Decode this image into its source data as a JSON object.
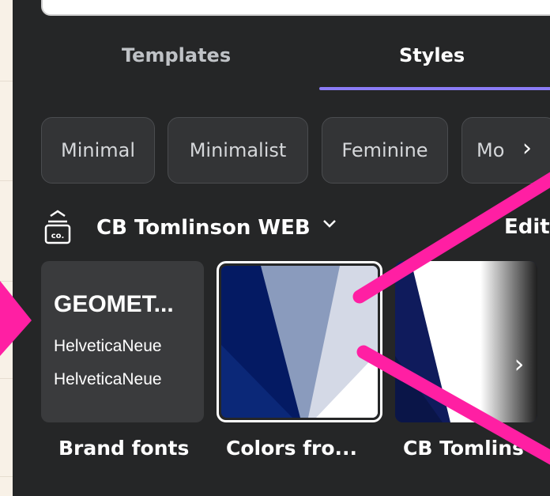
{
  "tabs": [
    {
      "label": "Templates",
      "active": false
    },
    {
      "label": "Styles",
      "active": true
    }
  ],
  "style_chips": [
    "Minimal",
    "Minimalist",
    "Feminine",
    "Mo"
  ],
  "chip_next_icon": "chevron-right-icon",
  "brand_kit": {
    "icon": "brand-kit-icon",
    "icon_text": "co.",
    "name": "CB Tomlinson WEB",
    "dropdown_icon": "chevron-down-icon",
    "edit_label": "Edit"
  },
  "cards": [
    {
      "label": "Brand fonts",
      "heading_font": "GEOMET...",
      "body_fonts": [
        "HelveticaNeue",
        "HelveticaNeue"
      ]
    },
    {
      "label": "Colors fro...",
      "palette": [
        "#041a63",
        "#8a9bbd",
        "#d4d9e6",
        "#ffffff"
      ]
    },
    {
      "label": "CB Tomlins",
      "colors": [
        "#0f1b5c",
        "#ffffff",
        "#222222"
      ]
    }
  ],
  "card_next_icon": "chevron-right-icon",
  "colors": {
    "panel_bg": "#252627",
    "page_bg": "#f8f1e7",
    "accent_underline": "#8b7cf6",
    "annotation_arrows": "#ff1fa3"
  }
}
